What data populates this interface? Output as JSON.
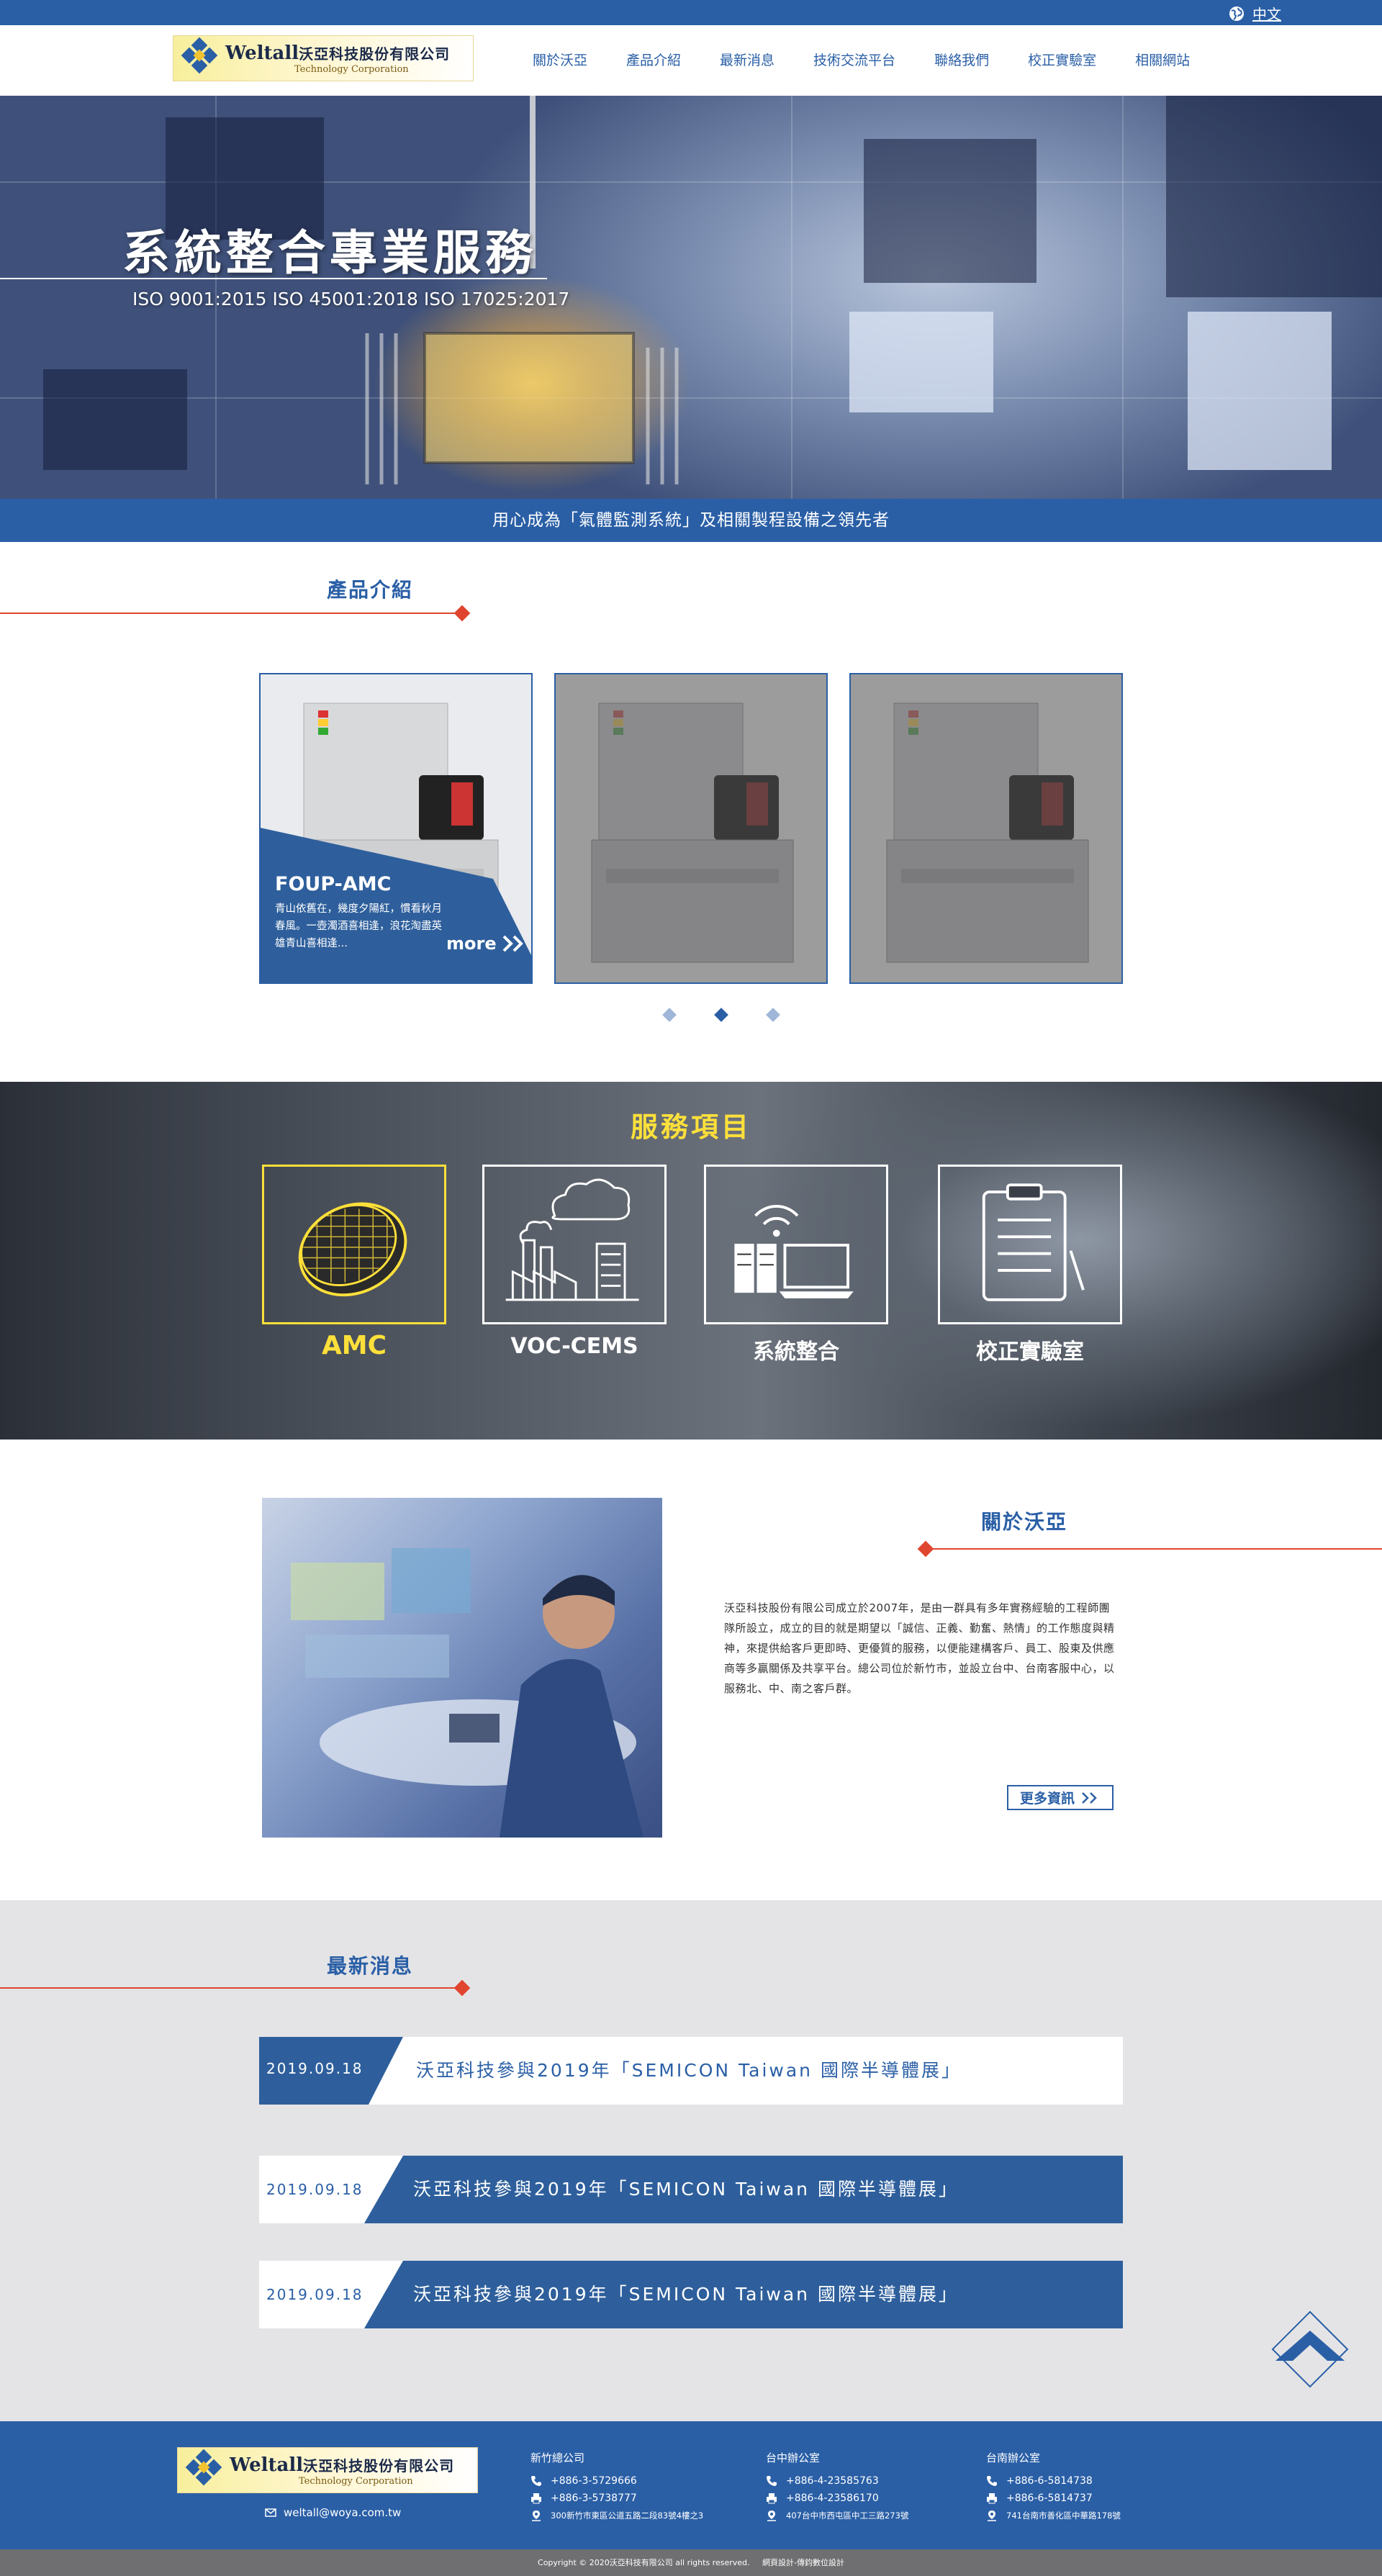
{
  "lang": {
    "label": "中文"
  },
  "logo": {
    "en": "Weltall",
    "zh": "沃亞科技股份有限公司",
    "sub": "Technology Corporation"
  },
  "nav": [
    "關於沃亞",
    "產品介紹",
    "最新消息",
    "技術交流平台",
    "聯絡我們",
    "校正實驗室",
    "相關網站"
  ],
  "hero": {
    "title": "系統整合專業服務",
    "subtitle": "ISO 9001:2015   ISO 45001:2018   ISO 17025:2017"
  },
  "slogan": "用心成為「氣體監測系統」及相關製程設備之領先者",
  "products": {
    "title": "產品介紹",
    "featured": {
      "name": "FOUP-AMC",
      "desc": "青山依舊在，幾度夕陽紅，慣看秋月春風。一壺濁酒喜相逢，浪花淘盡英雄青山喜相逢...",
      "more": "more"
    }
  },
  "services": {
    "title": "服務項目",
    "items": [
      "AMC",
      "VOC-CEMS",
      "系統整合",
      "校正實驗室"
    ],
    "active_index": 0
  },
  "about": {
    "title": "關於沃亞",
    "text": "沃亞科技股份有限公司成立於2007年，是由一群具有多年實務經驗的工程師團隊所設立，成立的目的就是期望以「誠信、正義、勤奮、熱情」的工作態度與精神，來提供給客戶更即時、更優質的服務，以便能建構客戶、員工、股東及供應商等多贏關係及共享平台。總公司位於新竹市，並設立台中、台南客服中心，以服務北、中、南之客戶群。",
    "more": "更多資訊"
  },
  "news": {
    "title": "最新消息",
    "items": [
      {
        "date": "2019.09.18",
        "text": "沃亞科技參與2019年「SEMICON Taiwan 國際半導體展」"
      },
      {
        "date": "2019.09.18",
        "text": "沃亞科技參與2019年「SEMICON Taiwan 國際半導體展」"
      },
      {
        "date": "2019.09.18",
        "text": "沃亞科技參與2019年「SEMICON Taiwan 國際半導體展」"
      }
    ]
  },
  "footer": {
    "email": "weltall@woya.com.tw",
    "offices": [
      {
        "name": "新竹總公司",
        "tel": "+886-3-5729666",
        "fax": "+886-3-5738777",
        "addr": "300新竹市東區公道五路二段83號4樓之3"
      },
      {
        "name": "台中辦公室",
        "tel": "+886-4-23585763",
        "fax": "+886-4-23586170",
        "addr": "407台中市西屯區中工三路273號"
      },
      {
        "name": "台南辦公室",
        "tel": "+886-6-5814738",
        "fax": "+886-6-5814737",
        "addr": "741台南市善化區中華路178號"
      }
    ],
    "copyright": "Copyright © 2020沃亞科技有限公司 all rights reserved.",
    "design": "網頁設計-傳鈞數位設計"
  },
  "colors": {
    "primary": "#2a5fa6",
    "accent_red": "#e0452f",
    "accent_yellow": "#ffe03a",
    "news_bg": "#e4e4e6",
    "footer_bottom": "#6f6f71"
  }
}
